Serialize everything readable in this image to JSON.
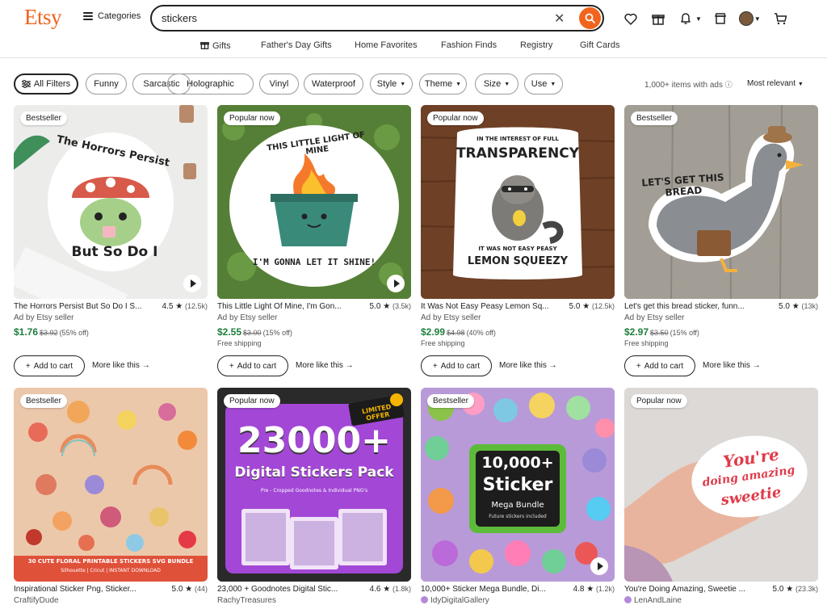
{
  "header": {
    "logo": "Etsy",
    "categories_label": "Categories",
    "search_value": "stickers",
    "nav": [
      "Gifts",
      "Father's Day Gifts",
      "Home Favorites",
      "Fashion Finds",
      "Registry",
      "Gift Cards"
    ]
  },
  "filters": {
    "all_filters": "All Filters",
    "chips": [
      "Funny",
      "Sarcastic",
      "Holographic",
      "Vinyl",
      "Waterproof"
    ],
    "dropdowns": [
      "Style",
      "Theme",
      "Size",
      "Use"
    ],
    "count": "1,000+ items with ads",
    "sort": "Most relevant"
  },
  "actions": {
    "add_to_cart": "Add to cart",
    "more_like_this": "More like this"
  },
  "colors": {
    "brand": "#F1641E",
    "price": "#1D7E3C"
  },
  "products": [
    {
      "badge": "Bestseller",
      "title": "The Horrors Persist But So Do I S...",
      "rating": "4.5",
      "reviews": "(12.5k)",
      "seller": "Ad by Etsy seller",
      "price": "$1.76",
      "original": "$3.92",
      "discount": "(55% off)",
      "shipping": "",
      "art_top": "The Horrors Persist",
      "art_bottom": "But So Do I"
    },
    {
      "badge": "Popular now",
      "title": "This Little Light Of Mine, I'm Gon...",
      "rating": "5.0",
      "reviews": "(3.5k)",
      "seller": "Ad by Etsy seller",
      "price": "$2.55",
      "original": "$3.00",
      "discount": "(15% off)",
      "shipping": "Free shipping",
      "art_top": "THIS LITTLE LIGHT OF MINE",
      "art_bottom": "I'M GONNA LET IT SHINE!"
    },
    {
      "badge": "Popular now",
      "title": "It Was Not Easy Peasy Lemon Sq...",
      "rating": "5.0",
      "reviews": "(12.5k)",
      "seller": "Ad by Etsy seller",
      "price": "$2.99",
      "original": "$4.98",
      "discount": "(40% off)",
      "shipping": "Free shipping",
      "art_top": "IN THE INTEREST OF FULL",
      "art_mid": "TRANSPARENCY",
      "art_small": "IT WAS NOT EASY PEASY",
      "art_bottom": "LEMON SQUEEZY"
    },
    {
      "badge": "Bestseller",
      "title": "Let's get this bread sticker, funn...",
      "rating": "5.0",
      "reviews": "(13k)",
      "seller": "Ad by Etsy seller",
      "price": "$2.97",
      "original": "$3.50",
      "discount": "(15% off)",
      "shipping": "Free shipping",
      "art_top": "LET'S GET THIS BREAD"
    },
    {
      "badge": "Bestseller",
      "title": "Inspirational Sticker Png, Sticker...",
      "rating": "5.0",
      "reviews": "(44)",
      "seller": "CraftifyDude",
      "art_banner": "30 CUTE FLORAL PRINTABLE STICKERS SVG BUNDLE",
      "art_sub": "Silhouette | Cricut | INSTANT DOWNLOAD"
    },
    {
      "badge": "Popular now",
      "title": "23,000 + Goodnotes Digital Stic...",
      "rating": "4.6",
      "reviews": "(1.8k)",
      "seller": "RachyTreasures",
      "art_big": "23000+",
      "art_mid": "Digital Stickers Pack",
      "art_flag": "LIMITED OFFER",
      "art_small": "Pre - Cropped Goodnotes & Individual PNG's"
    },
    {
      "badge": "Bestseller",
      "title": "10,000+ Sticker Mega Bundle, Di...",
      "rating": "4.8",
      "reviews": "(1.2k)",
      "seller": "IdyDigitalGallery",
      "art_big": "10,000+",
      "art_mid": "Sticker",
      "art_small": "Mega Bundle",
      "art_tiny": "Future stickers included"
    },
    {
      "badge": "Popular now",
      "title": "You're Doing Amazing, Sweetie ...",
      "rating": "5.0",
      "reviews": "(23.3k)",
      "seller": "LenAndLaine",
      "art_top": "You're",
      "art_mid": "doing amazing",
      "art_bottom": "sweetie"
    }
  ]
}
